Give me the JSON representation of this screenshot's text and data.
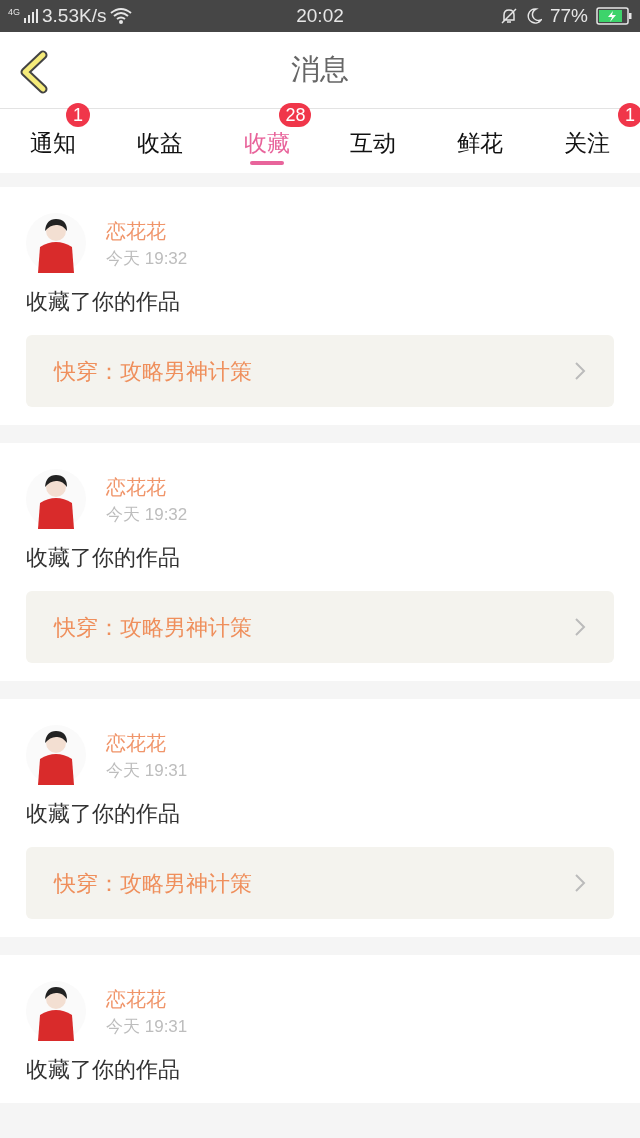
{
  "status_bar": {
    "network": "4G",
    "speed": "3.53K/s",
    "time": "20:02",
    "battery": "77%"
  },
  "header": {
    "title": "消息"
  },
  "tabs": [
    {
      "label": "通知",
      "selected": false,
      "badge": "1"
    },
    {
      "label": "收益",
      "selected": false
    },
    {
      "label": "收藏",
      "selected": true,
      "badge": "28"
    },
    {
      "label": "互动",
      "selected": false
    },
    {
      "label": "鲜花",
      "selected": false
    },
    {
      "label": "关注",
      "selected": false,
      "badge": "1"
    }
  ],
  "messages": [
    {
      "user": "恋花花",
      "time": "今天 19:32",
      "text": "收藏了你的作品",
      "work": "快穿：攻略男神计策"
    },
    {
      "user": "恋花花",
      "time": "今天 19:32",
      "text": "收藏了你的作品",
      "work": "快穿：攻略男神计策"
    },
    {
      "user": "恋花花",
      "time": "今天 19:31",
      "text": "收藏了你的作品",
      "work": "快穿：攻略男神计策"
    },
    {
      "user": "恋花花",
      "time": "今天 19:31",
      "text": "收藏了你的作品"
    }
  ]
}
